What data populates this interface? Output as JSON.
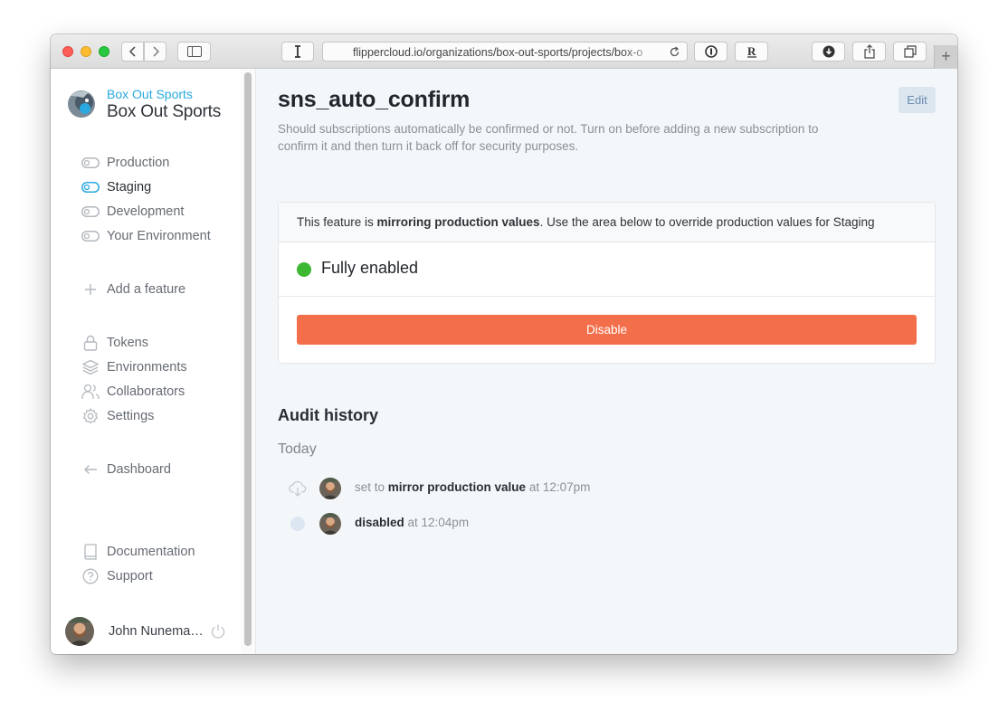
{
  "browser": {
    "url": "flippercloud.io/organizations/box-out-sports/projects/box-o",
    "toolbar_icons": [
      "chevron-left-icon",
      "chevron-right-icon",
      "sidebar-icon",
      "text-cursor-icon",
      "reload-icon",
      "password-icon",
      "readability-icon",
      "download-icon",
      "share-icon",
      "tabs-icon",
      "plus-icon"
    ],
    "traffic_colors": {
      "close": "#fd5f57",
      "minimize": "#febb2e",
      "zoom": "#28c840"
    }
  },
  "brand": {
    "organization": "Box Out Sports",
    "project": "Box Out Sports"
  },
  "sidebar": {
    "environments": [
      {
        "label": "Production",
        "active": false
      },
      {
        "label": "Staging",
        "active": true
      },
      {
        "label": "Development",
        "active": false
      },
      {
        "label": "Your Environment",
        "active": false
      }
    ],
    "add_feature": "Add a feature",
    "settings_links": [
      {
        "label": "Tokens",
        "icon": "lock-icon"
      },
      {
        "label": "Environments",
        "icon": "layers-icon"
      },
      {
        "label": "Collaborators",
        "icon": "users-icon"
      },
      {
        "label": "Settings",
        "icon": "gear-icon"
      }
    ],
    "dashboard": "Dashboard",
    "help_links": [
      {
        "label": "Documentation",
        "icon": "book-icon"
      },
      {
        "label": "Support",
        "icon": "help-circle-icon"
      }
    ],
    "user": {
      "name": "John Nunemaker"
    }
  },
  "feature": {
    "title": "sns_auto_confirm",
    "description": "Should subscriptions automatically be confirmed or not. Turn on before adding a new subscription to confirm it and then turn it back off for security purposes.",
    "edit_label": "Edit",
    "notice": {
      "prefix": "This feature is ",
      "emphasis": "mirroring production values",
      "suffix": ". Use the area below to override production values for Staging"
    },
    "status": "Fully enabled",
    "status_color": "#3cb832",
    "disable_label": "Disable",
    "accent_color": "#f36f4b"
  },
  "audit": {
    "title": "Audit history",
    "day": "Today",
    "events": [
      {
        "prefix": "set to ",
        "action": "mirror production value",
        "time": " at 12:07pm",
        "icon": "cloud-download-icon"
      },
      {
        "prefix": "",
        "action": "disabled",
        "time": " at 12:04pm",
        "icon": "dot-icon"
      }
    ]
  }
}
